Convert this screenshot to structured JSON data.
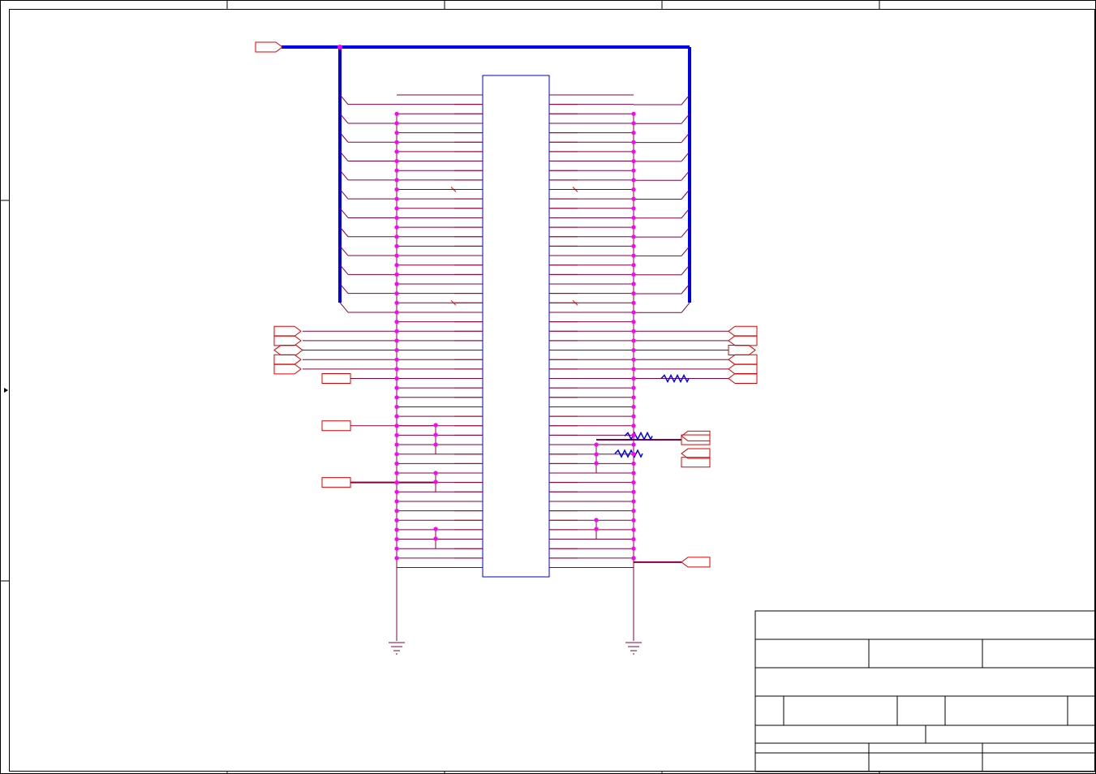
{
  "sheet": {
    "kind": "schematic",
    "colors": {
      "frame": "#000000",
      "component": "#0000cc",
      "bus": "#0000ee",
      "wire": "#800040",
      "pin": "#ff0000",
      "junction": "#ff00ff",
      "port": "#dd0000",
      "resistor": "#0000ee"
    }
  },
  "connector": {
    "pin_rows": 51,
    "no_connect_rows": [
      10,
      22
    ]
  },
  "bus": {
    "entries": 12
  },
  "left_ports": {
    "arrow_ports": 5,
    "box_ports": 3
  },
  "right_ports": {
    "arrow_ports": 6,
    "box_ports": 4
  },
  "resistors": {
    "count": 3
  },
  "grounds": {
    "count": 2
  },
  "title_block": {
    "present": true
  }
}
